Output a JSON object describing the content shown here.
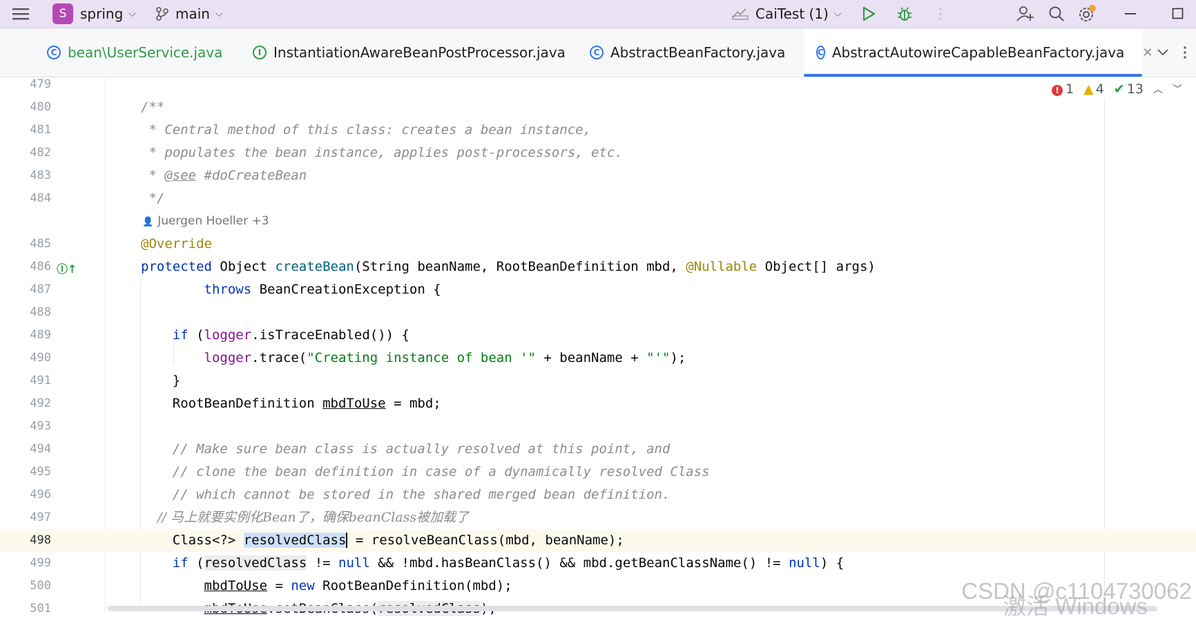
{
  "titlebar": {
    "project_badge": "S",
    "project_name": "spring",
    "branch": "main",
    "run_config": "CaiTest (1)"
  },
  "tabs": [
    {
      "label": "bean\\UserService.java",
      "icon": "class-icon",
      "color": "#2e9c46"
    },
    {
      "label": "InstantiationAwareBeanPostProcessor.java",
      "icon": "interface-icon"
    },
    {
      "label": "AbstractBeanFactory.java",
      "icon": "class-icon"
    },
    {
      "label": "AbstractAutowireCapableBeanFactory.java",
      "icon": "class-icon",
      "active": true
    }
  ],
  "inspections": {
    "errors": "1",
    "warnings": "4",
    "weak_warnings": "13"
  },
  "editor": {
    "author_hint": "Juergen Hoeller +3",
    "lines": {
      "l479": "479",
      "l480": "480",
      "l481": "481",
      "l482": "482",
      "l483": "483",
      "l484": "484",
      "l485": "485",
      "l486": "486",
      "l487": "487",
      "l488": "488",
      "l489": "489",
      "l490": "490",
      "l491": "491",
      "l492": "492",
      "l493": "493",
      "l494": "494",
      "l495": "495",
      "l496": "496",
      "l497": "497",
      "l498": "498",
      "l499": "499",
      "l500": "500",
      "l501": "501"
    }
  },
  "watermark": {
    "text": "CSDN @c1104730062",
    "text2": "激活 Windows"
  },
  "colors": {
    "keyword": "#0033b3",
    "comment": "#8c8c8c",
    "annotation": "#9e880d",
    "string": "#067d17",
    "field": "#871094",
    "accent": "#3574f0"
  }
}
